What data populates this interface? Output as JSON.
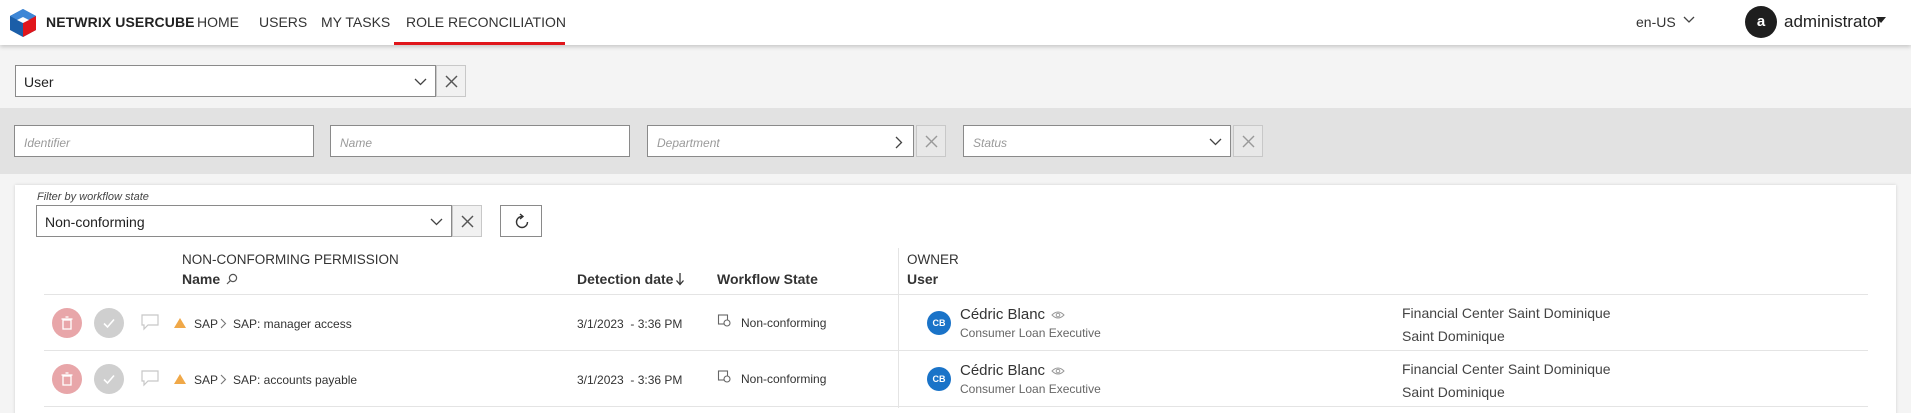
{
  "header": {
    "brand": "NETWRIX USERCUBE",
    "nav": [
      {
        "label": "HOME"
      },
      {
        "label": "USERS"
      },
      {
        "label": "MY TASKS"
      },
      {
        "label": "ROLE RECONCILIATION",
        "active": true
      }
    ],
    "language": "en-US",
    "user_initial": "a",
    "user_name": "administrator"
  },
  "entity_select": {
    "value": "User"
  },
  "filters": {
    "identifier_placeholder": "Identifier",
    "name_placeholder": "Name",
    "department_placeholder": "Department",
    "status_placeholder": "Status"
  },
  "workflow_filter": {
    "label": "Filter by workflow state",
    "value": "Non-conforming"
  },
  "table": {
    "group_permission": "NON-CONFORMING PERMISSION",
    "col_name": "Name",
    "col_detection": "Detection date",
    "col_workflow": "Workflow State",
    "group_owner": "OWNER",
    "col_user": "User",
    "rows": [
      {
        "system": "SAP",
        "permission": "SAP: manager access",
        "date": "3/1/2023  - 3:36 PM",
        "state": "Non-conforming",
        "initials": "CB",
        "user_name": "Cédric Blanc",
        "user_title": "Consumer Loan Executive",
        "org_line1": "Financial Center Saint Dominique",
        "org_line2": "Saint Dominique"
      },
      {
        "system": "SAP",
        "permission": "SAP: accounts payable",
        "date": "3/1/2023  - 3:36 PM",
        "state": "Non-conforming",
        "initials": "CB",
        "user_name": "Cédric Blanc",
        "user_title": "Consumer Loan Executive",
        "org_line1": "Financial Center Saint Dominique",
        "org_line2": "Saint Dominique"
      }
    ]
  },
  "colors": {
    "accent": "#e0161b",
    "brand_blue": "#1a73c8",
    "warning": "#f0a848",
    "delete_action": "#e8a6a9"
  },
  "icons": [
    "usercube-logo-icon",
    "chevron-down-icon",
    "close-icon",
    "chevron-right-icon",
    "refresh-icon",
    "search-icon",
    "sort-down-icon",
    "trash-icon",
    "check-icon",
    "comment-icon",
    "warning-icon",
    "workflow-icon",
    "eye-icon"
  ]
}
